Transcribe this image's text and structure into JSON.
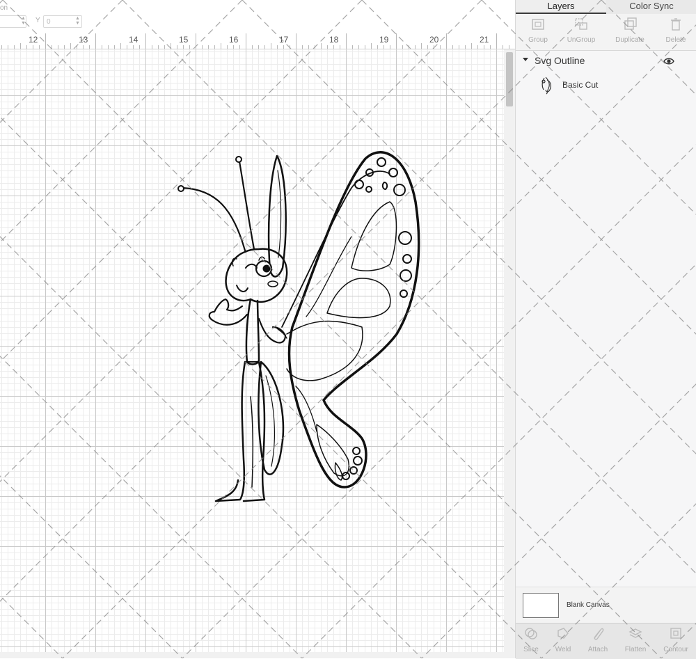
{
  "toolbar": {
    "position_label": "on",
    "y_axis_label": "Y",
    "y_value": "0"
  },
  "ruler": {
    "labels": [
      "12",
      "13",
      "14",
      "15",
      "16",
      "17",
      "18",
      "19",
      "20",
      "21"
    ]
  },
  "panel": {
    "tabs": [
      {
        "label": "Layers",
        "active": true
      },
      {
        "label": "Color Sync",
        "active": false
      }
    ],
    "actions": [
      {
        "label": "Group",
        "icon": "group-icon"
      },
      {
        "label": "UnGroup",
        "icon": "ungroup-icon"
      },
      {
        "label": "Duplicate",
        "icon": "duplicate-icon"
      },
      {
        "label": "Delete",
        "icon": "trash-icon"
      }
    ],
    "layer_group": {
      "title": "Svg Outline",
      "visible_icon": "eye-icon",
      "layers": [
        {
          "name": "Basic Cut",
          "icon": "butterfly-thumbnail-icon"
        }
      ]
    },
    "blank_canvas": {
      "label": "Blank Canvas",
      "color": "#ffffff"
    },
    "bottom_actions": [
      {
        "label": "Slice",
        "icon": "slice-icon"
      },
      {
        "label": "Weld",
        "icon": "weld-icon"
      },
      {
        "label": "Attach",
        "icon": "paperclip-icon"
      },
      {
        "label": "Flatten",
        "icon": "flatten-icon"
      },
      {
        "label": "Contour",
        "icon": "contour-icon"
      }
    ]
  },
  "colors": {
    "panel_bg": "#f3f3f3",
    "grid_major": "#c9c9c9",
    "grid_minor": "#ececec",
    "line_art": "#111111"
  }
}
